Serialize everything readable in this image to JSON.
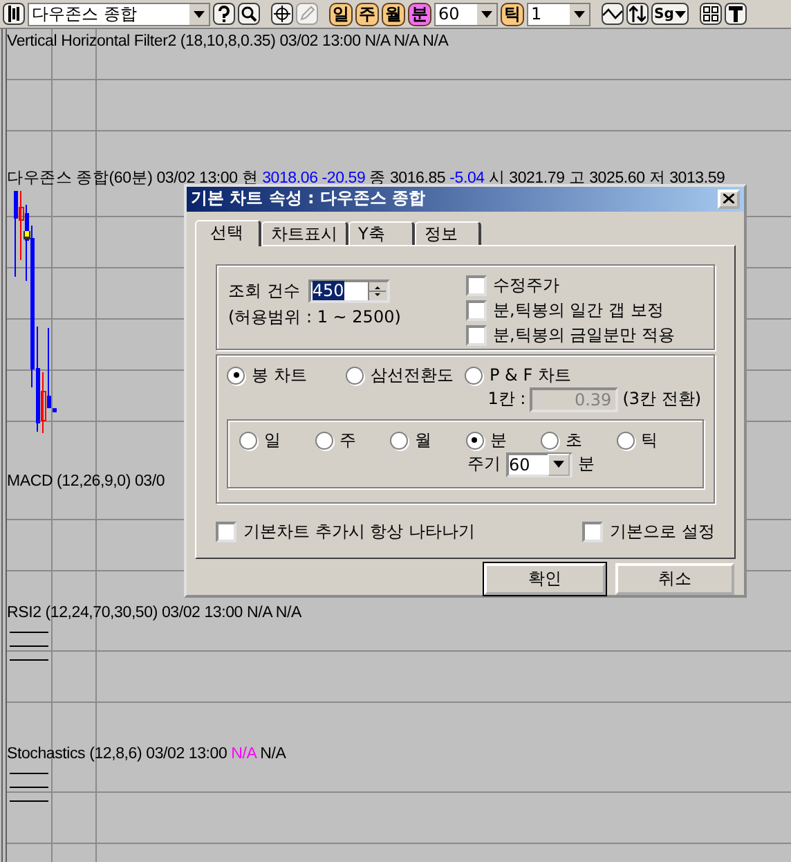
{
  "toolbar": {
    "symbol": "다우존스 종합",
    "periods": [
      {
        "label": "일",
        "selected": false
      },
      {
        "label": "주",
        "selected": false
      },
      {
        "label": "월",
        "selected": false
      },
      {
        "label": "분",
        "selected": true
      }
    ],
    "interval": "60",
    "tick_button": "틱",
    "tick_count": "1",
    "signal_button": "Sg"
  },
  "panes": [
    {
      "kind": "indicator",
      "segments": [
        {
          "text": "Vertical Horizontal Filter2 (18,10,8,0.35) 03/02 13:00 N/A N/A N/A"
        }
      ]
    },
    {
      "kind": "price",
      "segments": [
        {
          "text": "다우존스 종합(60분) 03/02 13:00  현 "
        },
        {
          "text": "3018.06 -20.59",
          "color": "#0000ff"
        },
        {
          "text": "  종 3016.85 "
        },
        {
          "text": "-5.04",
          "color": "#0000ff"
        },
        {
          "text": "  시 3021.79 고 3025.60 저 3013.59"
        }
      ]
    },
    {
      "kind": "indicator",
      "segments": [
        {
          "text": "MACD (12,26,9,0) 03/0"
        }
      ]
    },
    {
      "kind": "legend",
      "segments": [
        {
          "text": "RSI2 (12,24,70,30,50) 03/02 13:00 N/A N/A"
        }
      ]
    },
    {
      "kind": "legend",
      "segments": [
        {
          "text": "Stochastics (12,8,6) 03/02 13:00 "
        },
        {
          "text": "N/A",
          "color": "#ff00ff"
        },
        {
          "text": " N/A"
        }
      ]
    }
  ],
  "dialog": {
    "title": "기본 차트 속성 : 다우존스 종합",
    "tabs": [
      {
        "label": "선택",
        "selected": true
      },
      {
        "label": "차트표시",
        "selected": false
      },
      {
        "label": "Y축",
        "selected": false
      },
      {
        "label": "정보",
        "selected": false
      }
    ],
    "count_label": "조회 건수",
    "count_value": "450",
    "count_range": "(허용범위 : 1 ~ 2500)",
    "options": [
      {
        "label": "수정주가",
        "checked": false
      },
      {
        "label": "분,틱봉의 일간 갭 보정",
        "checked": false
      },
      {
        "label": "분,틱봉의 금일분만 적용",
        "checked": false
      }
    ],
    "chart_types": [
      {
        "label": "봉 차트",
        "selected": true
      },
      {
        "label": "삼선전환도",
        "selected": false
      },
      {
        "label": "P & F 차트",
        "selected": false
      }
    ],
    "box_label": "1칸 :",
    "box_value": "0.39",
    "box_disabled": true,
    "box_note": "(3칸 전환)",
    "periods": [
      {
        "label": "일",
        "selected": false
      },
      {
        "label": "주",
        "selected": false
      },
      {
        "label": "월",
        "selected": false
      },
      {
        "label": "분",
        "selected": true
      },
      {
        "label": "초",
        "selected": false
      },
      {
        "label": "틱",
        "selected": false
      }
    ],
    "cycle_label": "주기",
    "cycle_value": "60",
    "cycle_unit": "분",
    "bottom_options": [
      {
        "label": "기본차트 추가시 항상 나타나기",
        "checked": false
      },
      {
        "label": "기본으로 설정",
        "checked": false
      }
    ],
    "buttons": [
      {
        "label": "확인",
        "default": true
      },
      {
        "label": "취소",
        "default": false
      }
    ]
  }
}
